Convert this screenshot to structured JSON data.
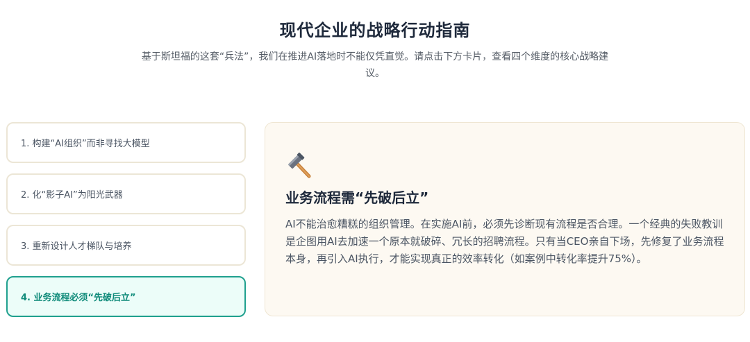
{
  "header": {
    "title": "现代企业的战略行动指南",
    "subtitle": "基于斯坦福的这套“兵法”，我们在推进AI落地时不能仅凭直觉。请点击下方卡片，查看四个维度的核心战略建议。"
  },
  "cards": [
    {
      "label": "1. 构建“AI组织”而非寻找大模型",
      "active": false
    },
    {
      "label": "2. 化“影子AI”为阳光武器",
      "active": false
    },
    {
      "label": "3. 重新设计人才梯队与培养",
      "active": false
    },
    {
      "label": "4. 业务流程必须“先破后立”",
      "active": true
    }
  ],
  "detail": {
    "icon": "hammer-icon",
    "heading": "业务流程需“先破后立”",
    "body": "AI不能治愈糟糕的组织管理。在实施AI前，必须先诊断现有流程是否合理。一个经典的失败教训是企图用AI去加速一个原本就破碎、冗长的招聘流程。只有当CEO亲自下场，先修复了业务流程本身，再引入AI执行，才能实现真正的效率转化（如案例中转化率提升75%）。"
  },
  "colors": {
    "accent": "#1fa08e",
    "active_bg": "#ecfdf9",
    "card_border": "#ece6d6",
    "detail_bg": "#fdf9f2"
  }
}
